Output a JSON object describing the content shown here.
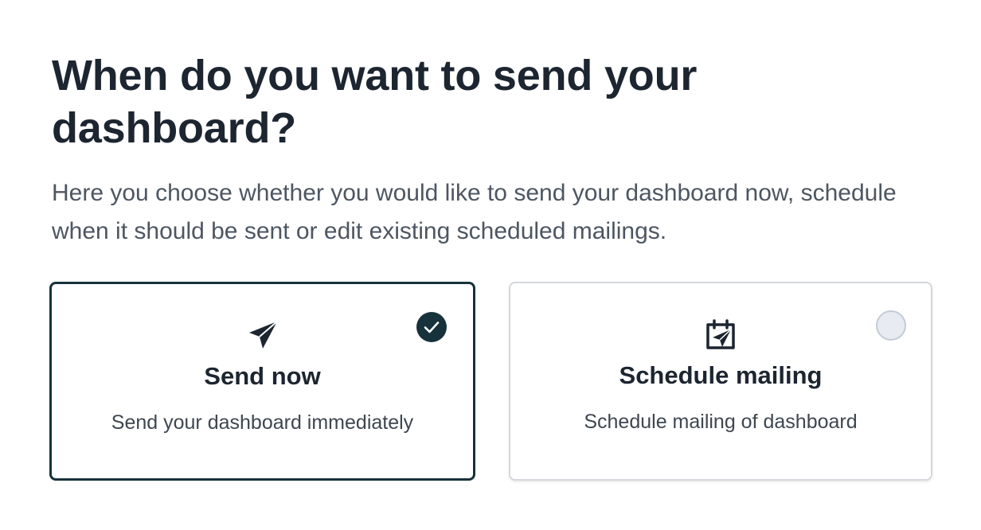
{
  "heading": "When do you want to send your dashboard?",
  "description": "Here you choose whether you would like to send your dashboard now, schedule when it should be sent or edit existing scheduled mailings.",
  "options": [
    {
      "title": "Send now",
      "description": "Send your dashboard immediately",
      "icon": "paper-plane-icon",
      "selected": true
    },
    {
      "title": "Schedule mailing",
      "description": "Schedule mailing of dashboard",
      "icon": "calendar-plane-icon",
      "selected": false
    }
  ],
  "colors": {
    "accent": "#17323b",
    "heading": "#1c2530",
    "body_text": "#4d5662",
    "unselected_border": "#d4d8dd",
    "radio_empty_fill": "#e8ecf2"
  }
}
